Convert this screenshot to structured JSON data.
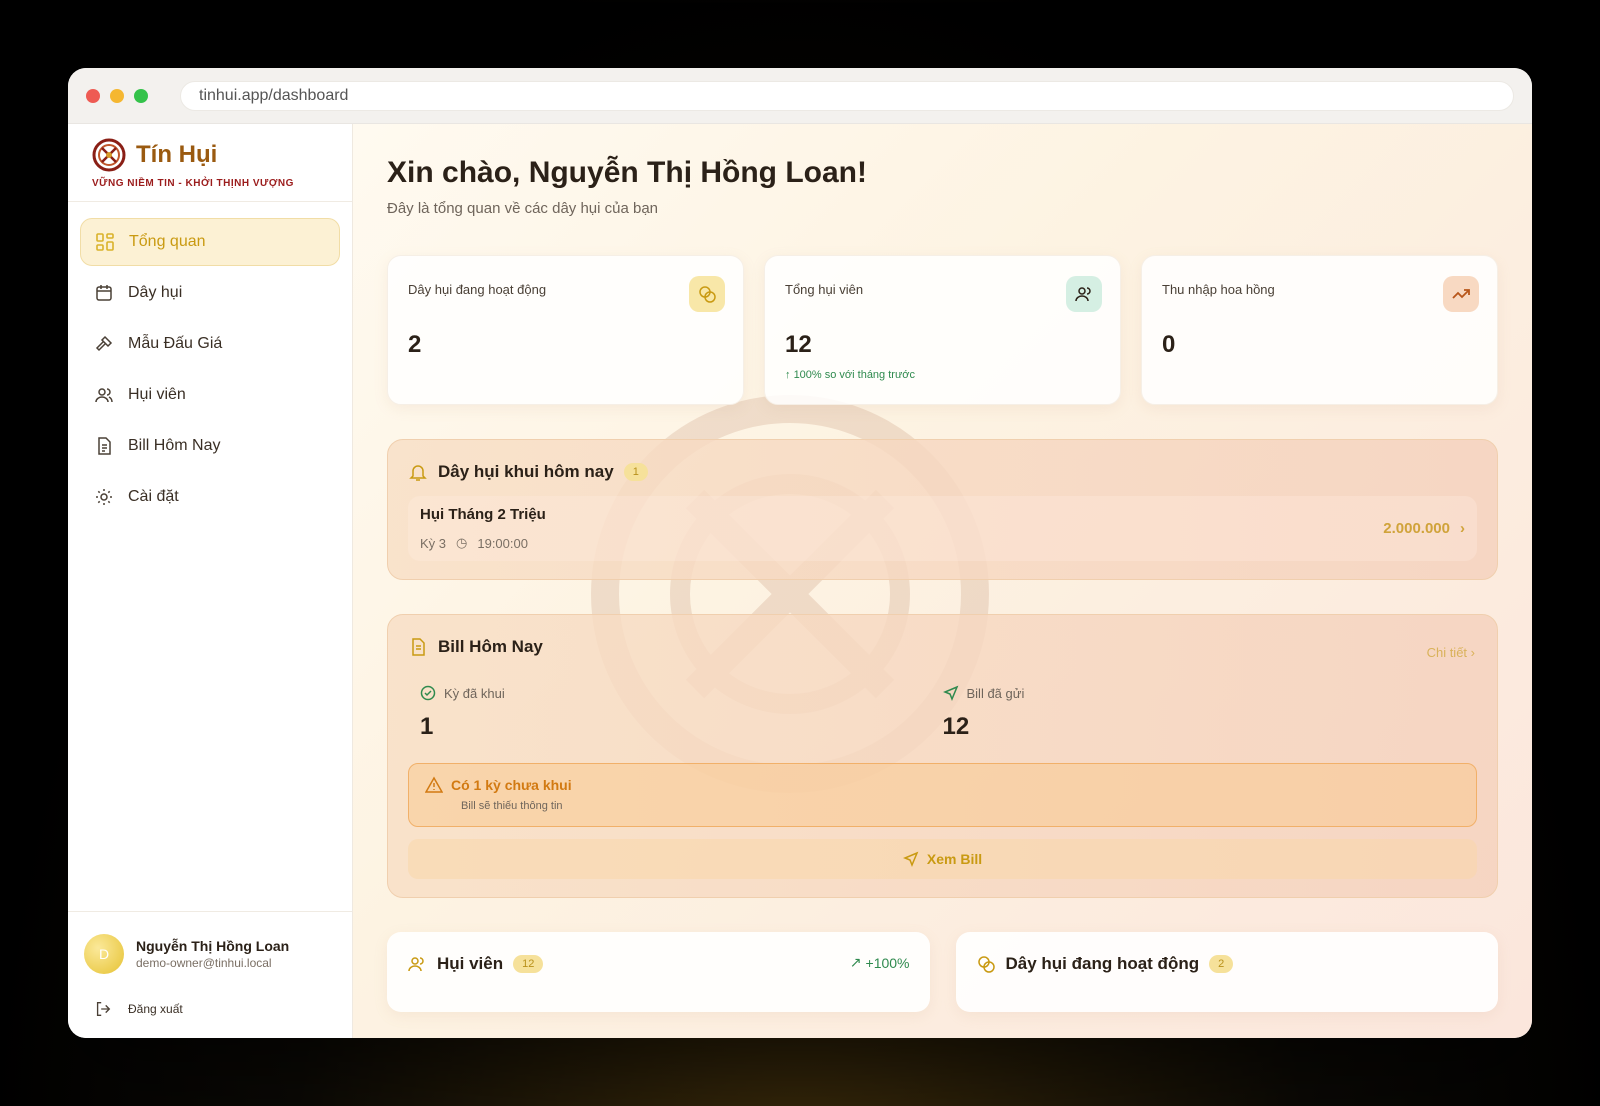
{
  "browser": {
    "url": "tinhui.app/dashboard"
  },
  "brand": {
    "name": "Tín Hụi",
    "tagline": "VỮNG NIỀM TIN - KHỞI THỊNH VƯỢNG"
  },
  "sidebar": {
    "items": [
      {
        "label": "Tổng quan",
        "icon": "grid-icon",
        "active": true
      },
      {
        "label": "Dây hụi",
        "icon": "calendar-icon"
      },
      {
        "label": "Mẫu Đấu Giá",
        "icon": "gavel-icon"
      },
      {
        "label": "Hụi viên",
        "icon": "users-icon"
      },
      {
        "label": "Bill Hôm Nay",
        "icon": "file-icon"
      },
      {
        "label": "Cài đặt",
        "icon": "gear-icon"
      }
    ],
    "user": {
      "initial": "D",
      "name": "Nguyễn Thị Hồng Loan",
      "email": "demo-owner@tinhui.local"
    },
    "logout": "Đăng xuất"
  },
  "header": {
    "greeting": "Xin chào, Nguyễn Thị Hồng Loan!",
    "subtitle": "Đây là tổng quan về các dây hụi của bạn"
  },
  "stats": [
    {
      "label": "Dây hụi đang hoạt động",
      "value": "2",
      "icon": "coins-icon",
      "color": "#f8e7a8"
    },
    {
      "label": "Tổng hụi viên",
      "value": "12",
      "trend": "100% so với tháng trước",
      "icon": "users-icon",
      "color": "#d5efe3"
    },
    {
      "label": "Thu nhập hoa hồng",
      "value": "0",
      "icon": "trend-up-icon",
      "color": "#f8d9c2"
    }
  ],
  "today": {
    "title": "Dây hụi khui hôm nay",
    "badge": "1",
    "item": {
      "name": "Hụi Tháng 2 Triệu",
      "period": "Kỳ 3",
      "time": "19:00:00",
      "amount": "2.000.000"
    }
  },
  "bill": {
    "title": "Bill Hôm Nay",
    "link": "Chi tiết",
    "opened_label": "Kỳ đã khui",
    "opened_value": "1",
    "sent_label": "Bill đã gửi",
    "sent_value": "12",
    "warning_title": "Có 1 kỳ chưa khui",
    "warning_sub": "Bill sẽ thiếu thông tin",
    "view_button": "Xem Bill"
  },
  "bottom": {
    "members": {
      "title": "Hụi viên",
      "badge": "12",
      "trend": "+100%"
    },
    "active": {
      "title": "Dây hụi đang hoạt động",
      "badge": "2"
    }
  }
}
